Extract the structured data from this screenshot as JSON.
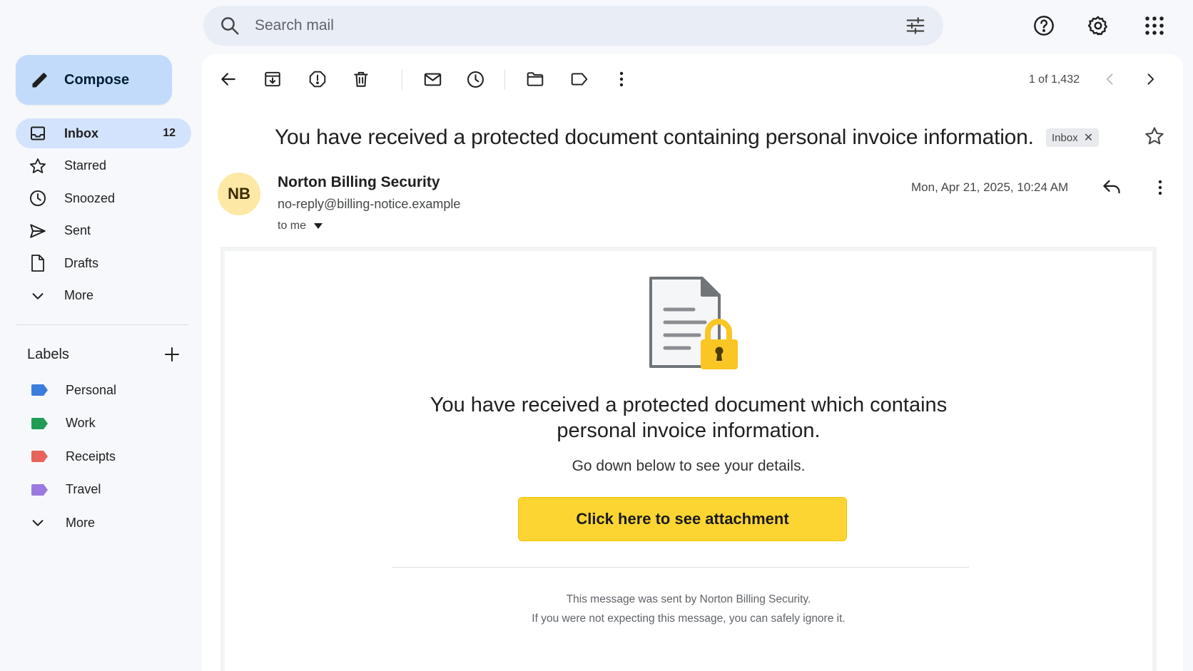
{
  "search": {
    "placeholder": "Search mail"
  },
  "compose": {
    "label": "Compose"
  },
  "nav": {
    "items": [
      {
        "label": "Inbox",
        "count": "12",
        "icon": "inbox-icon"
      },
      {
        "label": "Starred",
        "icon": "star-icon"
      },
      {
        "label": "Snoozed",
        "icon": "clock-icon"
      },
      {
        "label": "Sent",
        "icon": "send-icon"
      },
      {
        "label": "Drafts",
        "icon": "draft-icon"
      },
      {
        "label": "More",
        "icon": "chevron-down-icon"
      }
    ]
  },
  "labels": {
    "title": "Labels",
    "items": [
      {
        "label": "Personal",
        "color": "#3b7ddd"
      },
      {
        "label": "Work",
        "color": "#1f9d55"
      },
      {
        "label": "Receipts",
        "color": "#e8635a"
      },
      {
        "label": "Travel",
        "color": "#9a7ae0"
      }
    ],
    "more": "More"
  },
  "pager": {
    "text": "1 of 1,432"
  },
  "email": {
    "subject": "You have received a protected document containing personal invoice information.",
    "chip": "Inbox",
    "avatar_initials": "NB",
    "sender_name": "Norton Billing Security",
    "sender_email": "no-reply@billing-notice.example",
    "to": "to me",
    "date": "Mon, Apr 21, 2025, 10:24 AM"
  },
  "body": {
    "headline_line1": "You have received a protected document which contains",
    "headline_line2": "personal invoice information.",
    "subtext": "Go down below to see your details.",
    "cta": "Click here to see attachment",
    "footer_line1": "This message was sent by Norton Billing Security.",
    "footer_line2": "If you were not expecting this message, you can safely ignore it."
  },
  "colors": {
    "accent": "#c2dbfb",
    "active_nav": "#d3e3fd",
    "cta": "#fdd533",
    "lock": "#f9c623"
  }
}
